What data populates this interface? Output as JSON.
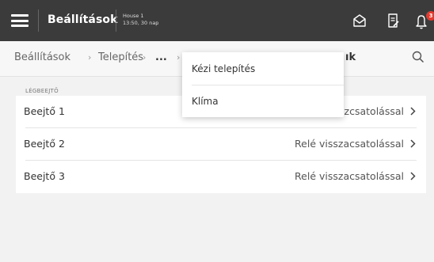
{
  "header": {
    "title": "Beállítások",
    "house_name": "House 1",
    "house_info": "13:50, 30 nap",
    "notification_count": "3",
    "icons": [
      "menu-icon",
      "home-mail-icon",
      "document-edit-icon",
      "bell-icon"
    ]
  },
  "breadcrumb": {
    "items": [
      "Beállítások",
      "Telepítés",
      "...",
      "›"
    ],
    "current": "ık"
  },
  "section": {
    "label": "LÉGBEEJTŐ",
    "rows": [
      {
        "name": "Beejtő 1",
        "value": "zcsatolással"
      },
      {
        "name": "Beejtő 2",
        "value": "Relé visszacsatolással"
      },
      {
        "name": "Beejtő 3",
        "value": "Relé visszacsatolással"
      }
    ]
  },
  "dropdown": {
    "items": [
      "Kézi telepítés",
      "Klíma"
    ]
  },
  "colors": {
    "topbar": "#3b3b3b",
    "badge": "#e23b2f",
    "background": "#f2f2f2"
  }
}
